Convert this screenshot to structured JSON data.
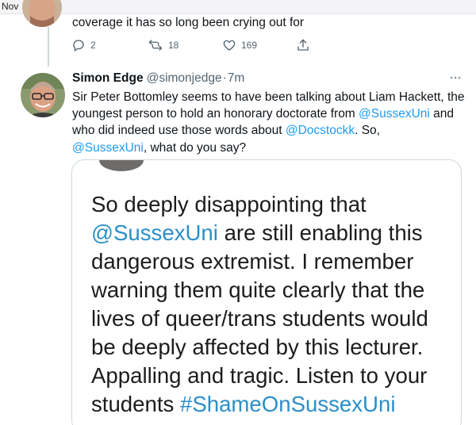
{
  "topbar": {
    "label": "Nov"
  },
  "previous_tweet": {
    "text": "coverage it has so long been crying out for",
    "stats": {
      "replies": "2",
      "retweets": "18",
      "likes": "169"
    }
  },
  "tweet": {
    "name": "Simon Edge",
    "handle": "@simonjedge",
    "separator": "·",
    "time": "7m",
    "text_part1": "Sir Peter Bottomley seems to have been talking about Liam Hackett, the youngest person to hold an honorary doctorate from ",
    "link1": "@SussexUni",
    "text_part2": " and who did indeed use those words about ",
    "link2": "@Docstockk",
    "text_part3": ". So, ",
    "link3": "@SussexUni",
    "text_part4": ", what do you say?"
  },
  "media": {
    "part1": "So deeply disappointing that ",
    "link1": "@SussexUni",
    "part2": " are still enabling this dangerous extremist. I remember warning them quite clearly that the lives of queer/trans students would be deeply affected by this lecturer. Appalling and tragic. Listen to your students ",
    "hashtag": "#ShameOnSussexUni"
  },
  "colors": {
    "link": "#1d9bf0",
    "muted": "#536471",
    "text": "#0f1419",
    "border": "#cfd9de"
  },
  "icons": [
    "reply-icon",
    "retweet-icon",
    "like-icon",
    "share-icon",
    "more-icon"
  ]
}
